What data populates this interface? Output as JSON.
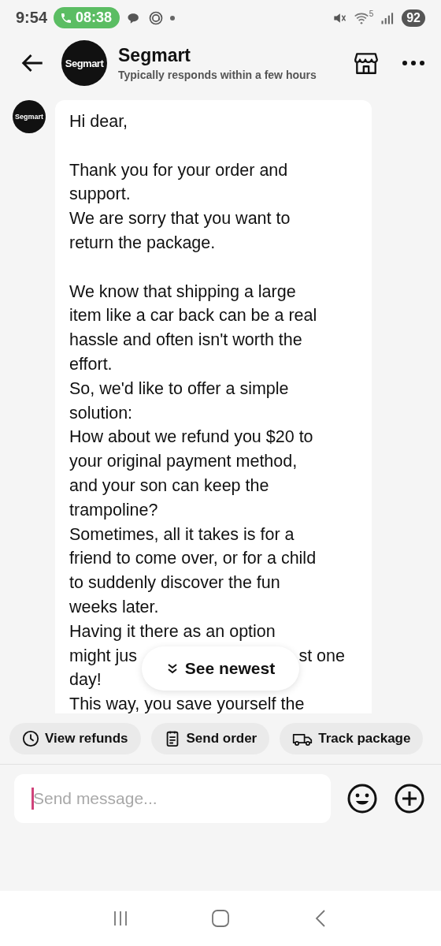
{
  "status_bar": {
    "time": "9:54",
    "call_timer": "08:38",
    "wifi_band": "5",
    "battery": "92"
  },
  "header": {
    "avatar_text": "Segmart",
    "title": "Segmart",
    "subtitle": "Typically responds within a few hours"
  },
  "message": {
    "avatar_text": "Segmart",
    "paragraphs": [
      [
        "Hi dear,"
      ],
      [
        "Thank you for your order and",
        "support.",
        "We are sorry that you want to",
        "return the package."
      ],
      [
        "We know that shipping a large",
        "item like a car back can be a real",
        "hassle and often isn't worth the",
        "effort.",
        "So, we'd like to offer a simple",
        "solution:",
        "How about we refund you $20 to",
        "your original payment method,",
        "and your son can keep the",
        "trampoline?",
        "Sometimes, all it takes is for a",
        "friend to come over, or for a child",
        "to suddenly discover the fun",
        "weeks later.",
        "Having it there as an option",
        [
          "might jus",
          "st one"
        ],
        "day!",
        "This way, you save yourself the"
      ]
    ]
  },
  "see_newest": "See newest",
  "quick_actions": [
    {
      "kind": "clock",
      "label": "View refunds"
    },
    {
      "kind": "clipboard",
      "label": "Send order"
    },
    {
      "kind": "truck",
      "label": "Track package"
    }
  ],
  "composer": {
    "placeholder": "Send message..."
  }
}
